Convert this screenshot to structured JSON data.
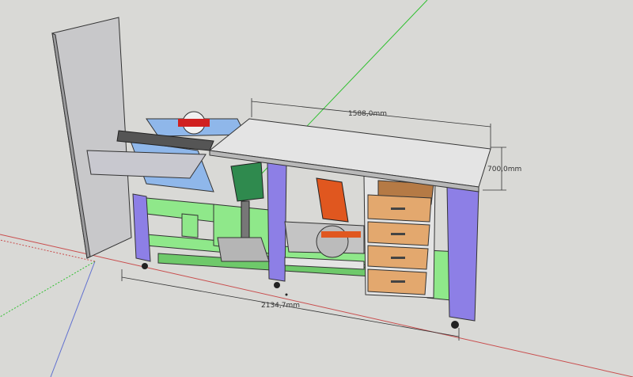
{
  "model": {
    "dimensions": {
      "top_width": "1588,0mm",
      "height": "700,0mm",
      "total_length": "2134,7mm"
    },
    "colors": {
      "background": "#d9d9d6",
      "frame_green": "#8fe88a",
      "leg_purple": "#8d7fe6",
      "top_gray": "#e4e4e4",
      "wall_gray": "#c8c8ca",
      "saw_blue": "#8fb7ea",
      "drill_green": "#2f8a4e",
      "miter_orange": "#e0571f",
      "drawer_wood": "#e3a86e",
      "axis_red": "#c94d4d",
      "axis_green": "#30c030",
      "axis_blue": "#6070d0"
    }
  }
}
